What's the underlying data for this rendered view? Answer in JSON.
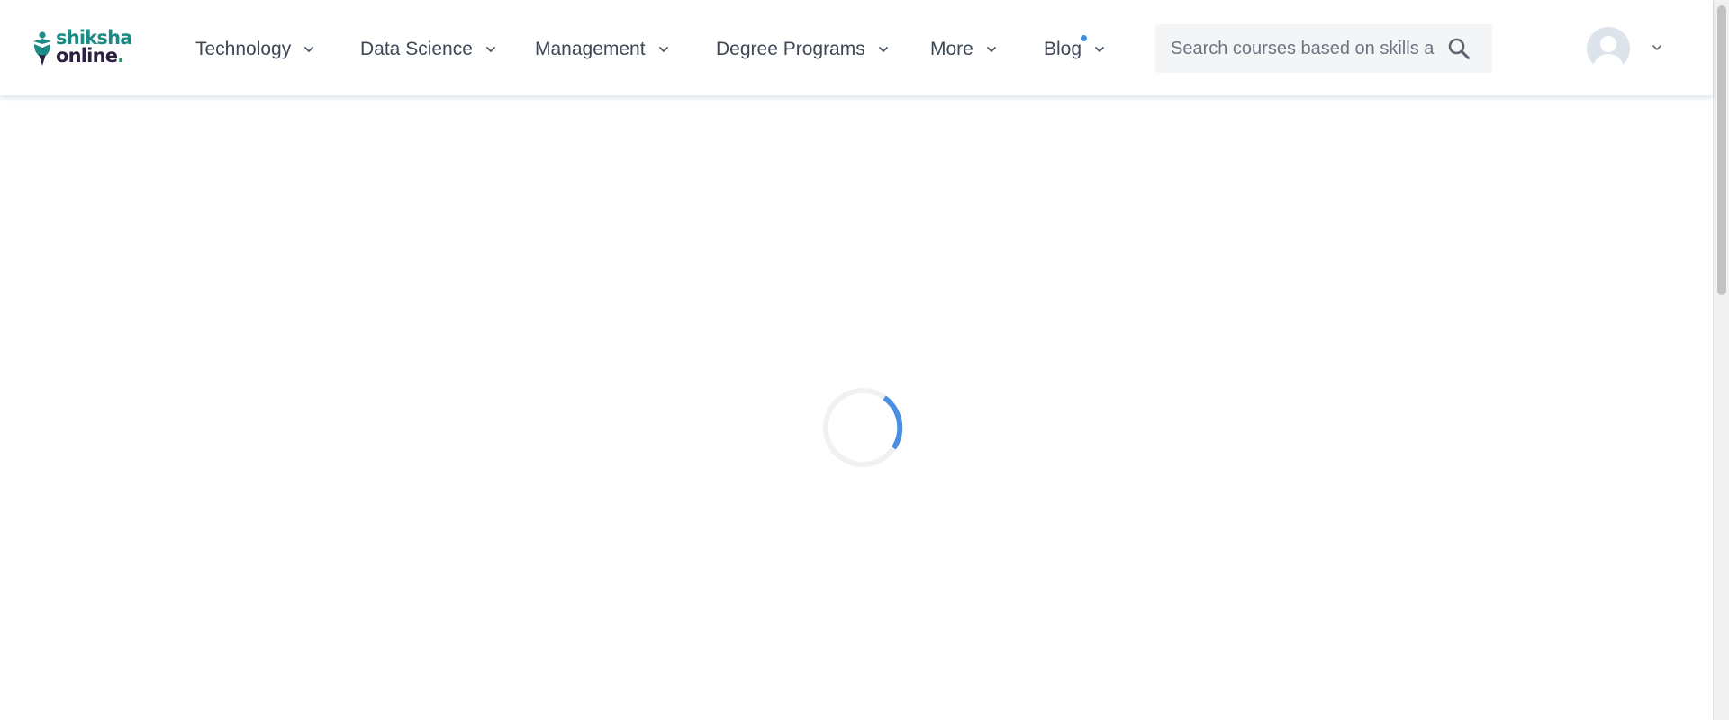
{
  "brand": {
    "logo_line1": "shiksha",
    "logo_line2": "online",
    "logo_dot": ".",
    "colors": {
      "primary_teal": "#1c8b86",
      "dark_purple": "#2b2040",
      "accent_green": "#1f9e67",
      "spinner_blue": "#4a90e2"
    }
  },
  "nav": {
    "items": [
      {
        "label": "Technology",
        "icon": "chevron-down-icon"
      },
      {
        "label": "Data Science",
        "icon": "chevron-down-icon"
      },
      {
        "label": "Management",
        "icon": "chevron-down-icon"
      },
      {
        "label": "Degree Programs",
        "icon": "chevron-down-icon"
      },
      {
        "label": "More",
        "icon": "chevron-down-icon"
      },
      {
        "label": "Blog",
        "icon": "chevron-down-icon",
        "has_notification_dot": true
      }
    ]
  },
  "search": {
    "placeholder": "Search courses based on skills a",
    "value": "",
    "icon": "search-icon"
  },
  "account": {
    "avatar_icon": "user-avatar-icon",
    "menu_icon": "chevron-down-icon"
  },
  "content": {
    "state": "loading",
    "spinner_icon": "loading-spinner-icon"
  }
}
